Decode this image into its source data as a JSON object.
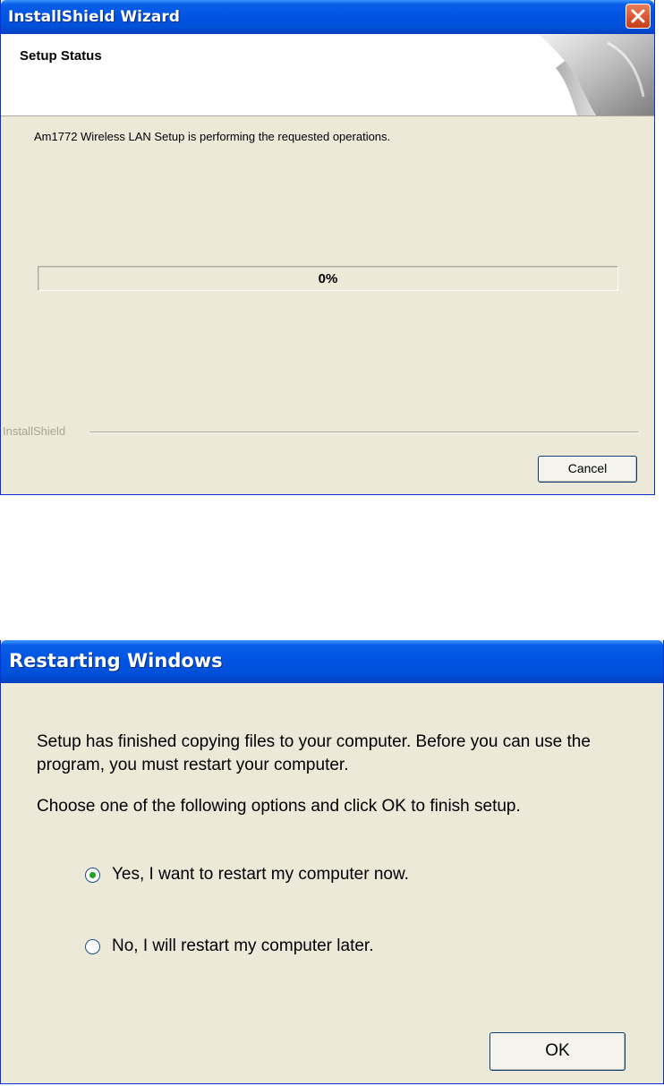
{
  "installer": {
    "title": "InstallShield Wizard",
    "header_title": "Setup Status",
    "message": "Am1772 Wireless LAN Setup is performing the requested operations.",
    "progress_percent": 0,
    "progress_label": "0%",
    "brand": "InstallShield",
    "cancel_label": "Cancel"
  },
  "restart_dialog": {
    "title": "Restarting Windows",
    "message_line1": "Setup has finished copying files to your computer.  Before you can use the program, you must restart your computer.",
    "message_line2": "Choose one of the following options and click OK to finish setup.",
    "options": [
      {
        "label": "Yes, I want to restart my computer now.",
        "selected": true
      },
      {
        "label": "No, I will restart my computer later.",
        "selected": false
      }
    ],
    "ok_label": "OK"
  },
  "colors": {
    "titlebar": "#0053e1",
    "dialog_bg": "#ece9d8",
    "close_button": "#d8542e"
  }
}
